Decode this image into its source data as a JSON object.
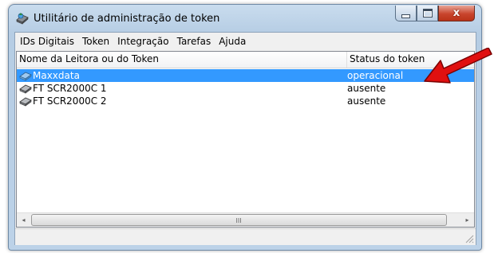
{
  "window": {
    "title": "Utilitário de administração de token",
    "close_glyph": "x"
  },
  "menu": {
    "items": [
      "IDs Digitais",
      "Token",
      "Integração",
      "Tarefas",
      "Ajuda"
    ]
  },
  "table": {
    "columns": [
      "Nome da Leitora ou do Token",
      "Status do token"
    ],
    "rows": [
      {
        "name": "Maxxdata",
        "status": "operacional",
        "selected": true
      },
      {
        "name": "FT SCR2000C 1",
        "status": "ausente",
        "selected": false
      },
      {
        "name": "FT SCR2000C 2",
        "status": "ausente",
        "selected": false
      }
    ]
  },
  "scrollbar": {
    "left_arrow": "◂",
    "right_arrow": "▸",
    "grip": "III"
  },
  "colors": {
    "selection": "#3399ff",
    "annotation_arrow": "#e01010"
  },
  "icons": {
    "app": "token-app-icon",
    "token": "token-device-icon",
    "annotation": "red-arrow-annotation"
  }
}
